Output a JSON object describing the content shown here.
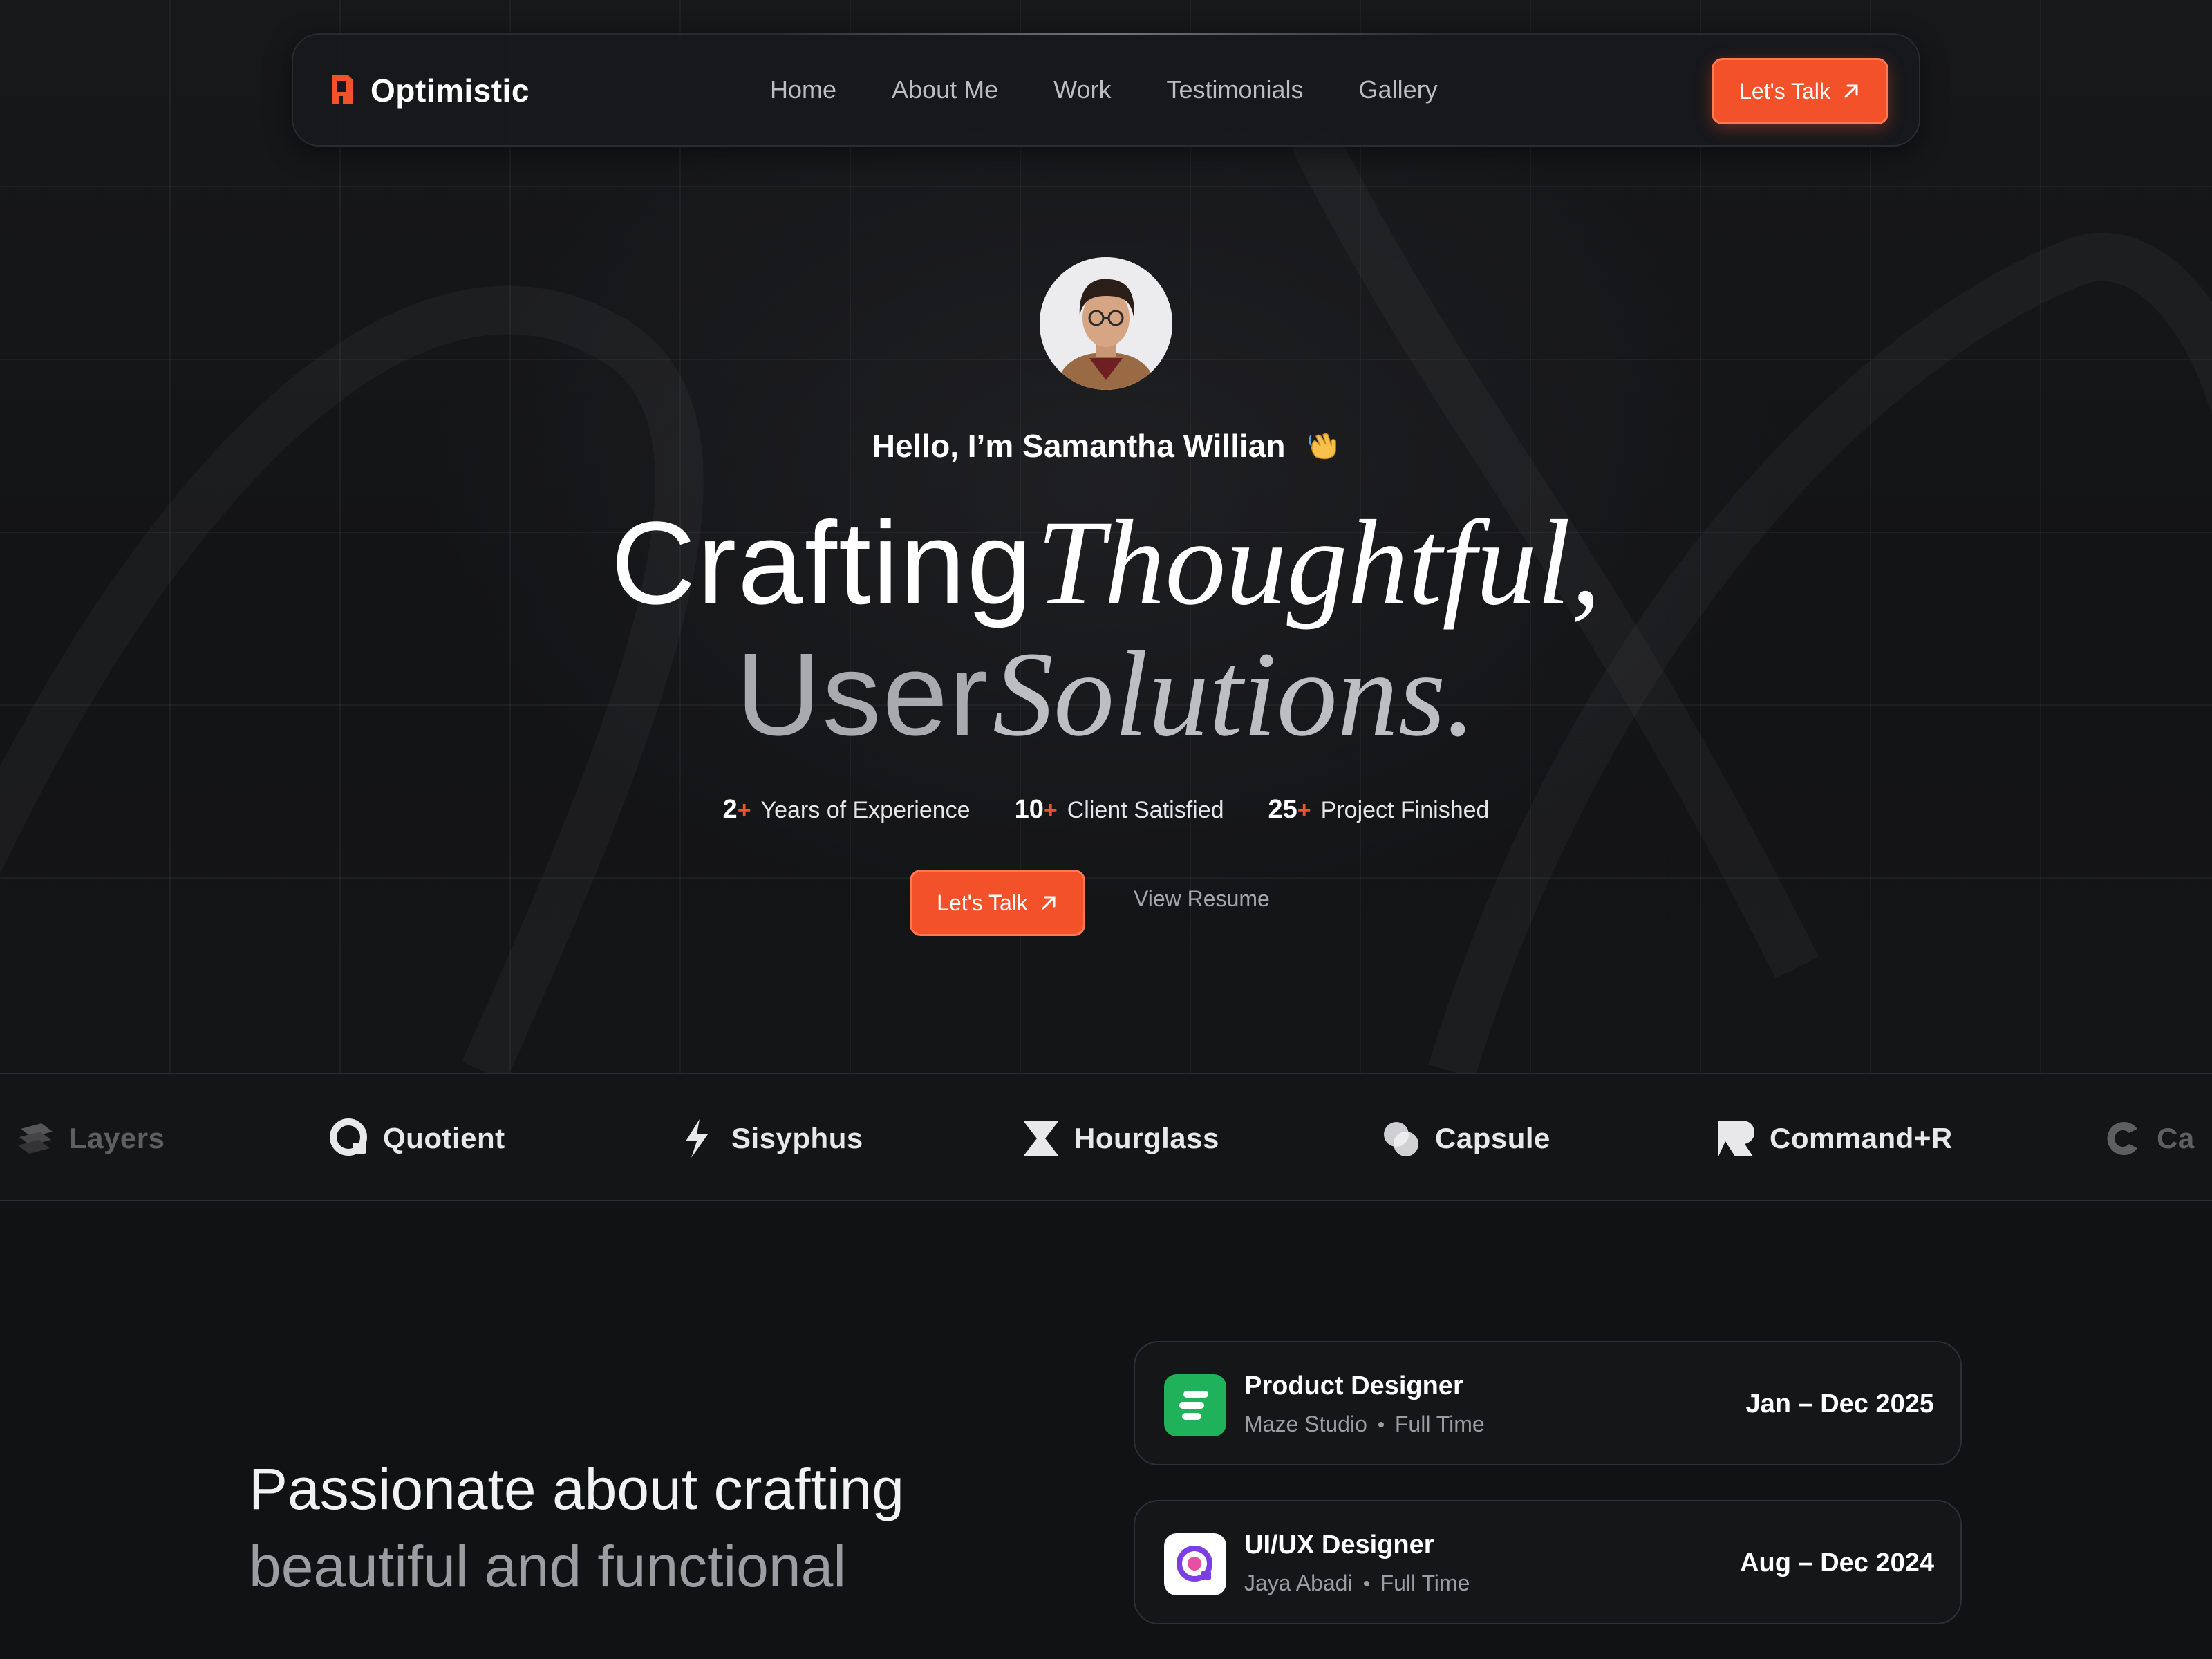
{
  "nav": {
    "brand": "Optimistic",
    "links": [
      "Home",
      "About Me",
      "Work",
      "Testimonials",
      "Gallery"
    ],
    "cta": "Let's Talk"
  },
  "hero": {
    "greeting": "Hello, I’m Samantha Willian",
    "headline_line1_sans": "Crafting",
    "headline_line1_serif": "Thoughtful,",
    "headline_line2_sans": "User",
    "headline_line2_serif": "Solutions.",
    "stats": [
      {
        "num": "2",
        "plus": "+",
        "label": "Years of Experience"
      },
      {
        "num": "10",
        "plus": "+",
        "label": "Client Satisfied"
      },
      {
        "num": "25",
        "plus": "+",
        "label": "Project Finished"
      }
    ],
    "cta": "Let's Talk",
    "secondary": "View Resume"
  },
  "logos": [
    "Layers",
    "Quotient",
    "Sisyphus",
    "Hourglass",
    "Capsule",
    "Command+R",
    "Ca"
  ],
  "lower": {
    "tagline_line1": "Passionate about crafting",
    "tagline_line2": "beautiful and functional"
  },
  "experience": [
    {
      "title": "Product Designer",
      "company": "Maze Studio",
      "type": "Full Time",
      "dates": "Jan – Dec 2025",
      "icon_color": "#1fb25a"
    },
    {
      "title": "UI/UX Designer",
      "company": "Jaya Abadi",
      "type": "Full Time",
      "dates": "Aug – Dec 2024",
      "icon_color": "#ffffff"
    }
  ],
  "colors": {
    "accent": "#f2512a",
    "background": "#111214"
  }
}
